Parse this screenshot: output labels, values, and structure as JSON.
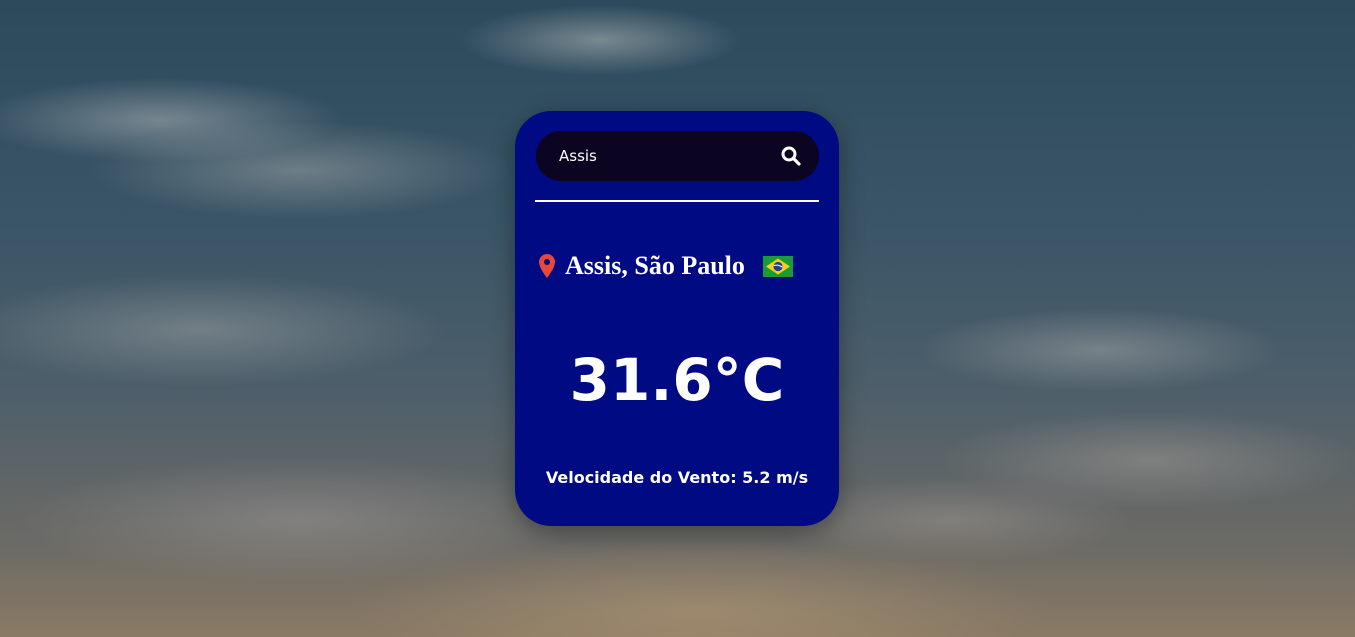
{
  "search": {
    "value": "Assis",
    "icon": "search-icon"
  },
  "location": {
    "icon": "map-pin-icon",
    "label": "Assis, São Paulo",
    "flag": "brazil-flag-icon"
  },
  "weather": {
    "temperature": "31.6°C",
    "wind": "Velocidade do Vento: 5.2 m/s"
  },
  "colors": {
    "card": "#000a82",
    "search_bg": "#0b0522",
    "pin": "#e8473a"
  }
}
